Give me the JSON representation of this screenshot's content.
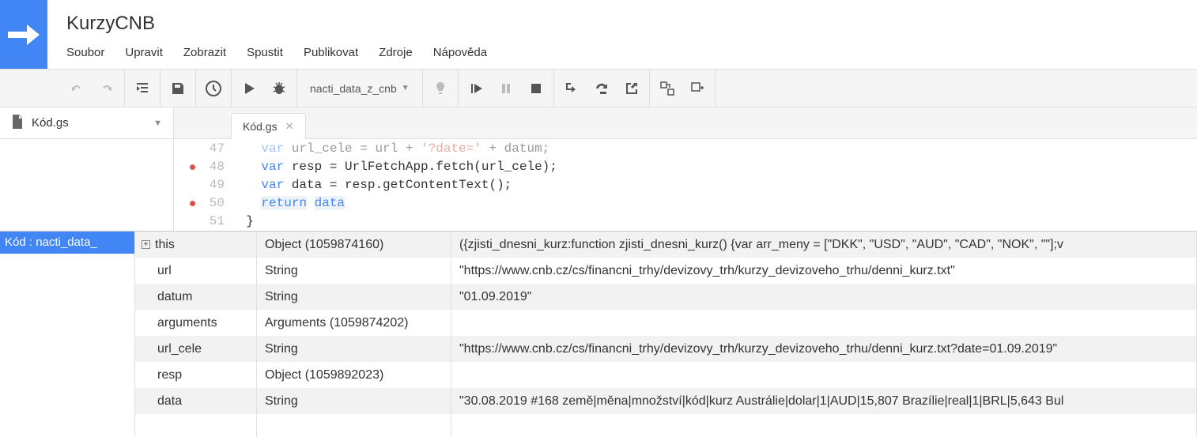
{
  "header": {
    "title": "KurzyCNB",
    "menu": [
      "Soubor",
      "Upravit",
      "Zobrazit",
      "Spustit",
      "Publikovat",
      "Zdroje",
      "Nápověda"
    ]
  },
  "toolbar": {
    "function_select": "nacti_data_z_cnb"
  },
  "files": {
    "active": "Kód.gs"
  },
  "tabs": {
    "active": "Kód.gs"
  },
  "code": {
    "lines": [
      {
        "num": "47",
        "bp": false,
        "cut": true,
        "seg": [
          {
            "t": "    ",
            "c": ""
          },
          {
            "t": "var",
            "c": "kw"
          },
          {
            "t": " url_cele = url + ",
            "c": ""
          },
          {
            "t": "'?date='",
            "c": "str"
          },
          {
            "t": " + datum;",
            "c": ""
          }
        ]
      },
      {
        "num": "48",
        "bp": true,
        "cut": false,
        "seg": [
          {
            "t": "    ",
            "c": ""
          },
          {
            "t": "var",
            "c": "kw"
          },
          {
            "t": " resp = UrlFetchApp.",
            "c": ""
          },
          {
            "t": "fetch",
            "c": "fn"
          },
          {
            "t": "(url_cele);",
            "c": ""
          }
        ]
      },
      {
        "num": "49",
        "bp": false,
        "cut": false,
        "seg": [
          {
            "t": "    ",
            "c": ""
          },
          {
            "t": "var",
            "c": "kw"
          },
          {
            "t": " data = resp.",
            "c": ""
          },
          {
            "t": "getContentText",
            "c": "fn"
          },
          {
            "t": "();",
            "c": ""
          }
        ]
      },
      {
        "num": "50",
        "bp": true,
        "cut": false,
        "hl": true,
        "seg": [
          {
            "t": "    ",
            "c": ""
          },
          {
            "t": "return",
            "c": "kw"
          },
          {
            "t": " ",
            "c": ""
          },
          {
            "t": "data",
            "c": "var"
          }
        ]
      },
      {
        "num": "51",
        "bp": false,
        "cut": false,
        "seg": [
          {
            "t": "  }",
            "c": ""
          }
        ]
      }
    ]
  },
  "debug": {
    "stack_label": "Kód : nacti_data_",
    "vars": [
      {
        "name": "this",
        "type": "Object (1059874160)",
        "value": "({zjisti_dnesni_kurz:function zjisti_dnesni_kurz() {var arr_meny = [\"DKK\", \"USD\", \"AUD\", \"CAD\", \"NOK\", \"\"];v",
        "expandable": true
      },
      {
        "name": "url",
        "type": "String",
        "value": "\"https://www.cnb.cz/cs/financni_trhy/devizovy_trh/kurzy_devizoveho_trhu/denni_kurz.txt\""
      },
      {
        "name": "datum",
        "type": "String",
        "value": "\"01.09.2019\""
      },
      {
        "name": "arguments",
        "type": "Arguments (1059874202)",
        "value": ""
      },
      {
        "name": "url_cele",
        "type": "String",
        "value": "\"https://www.cnb.cz/cs/financni_trhy/devizovy_trh/kurzy_devizoveho_trhu/denni_kurz.txt?date=01.09.2019\""
      },
      {
        "name": "resp",
        "type": "Object (1059892023)",
        "value": ""
      },
      {
        "name": "data",
        "type": "String",
        "value": "\"30.08.2019 #168 země|měna|množství|kód|kurz Austrálie|dolar|1|AUD|15,807 Brazílie|real|1|BRL|5,643 Bul"
      }
    ]
  }
}
